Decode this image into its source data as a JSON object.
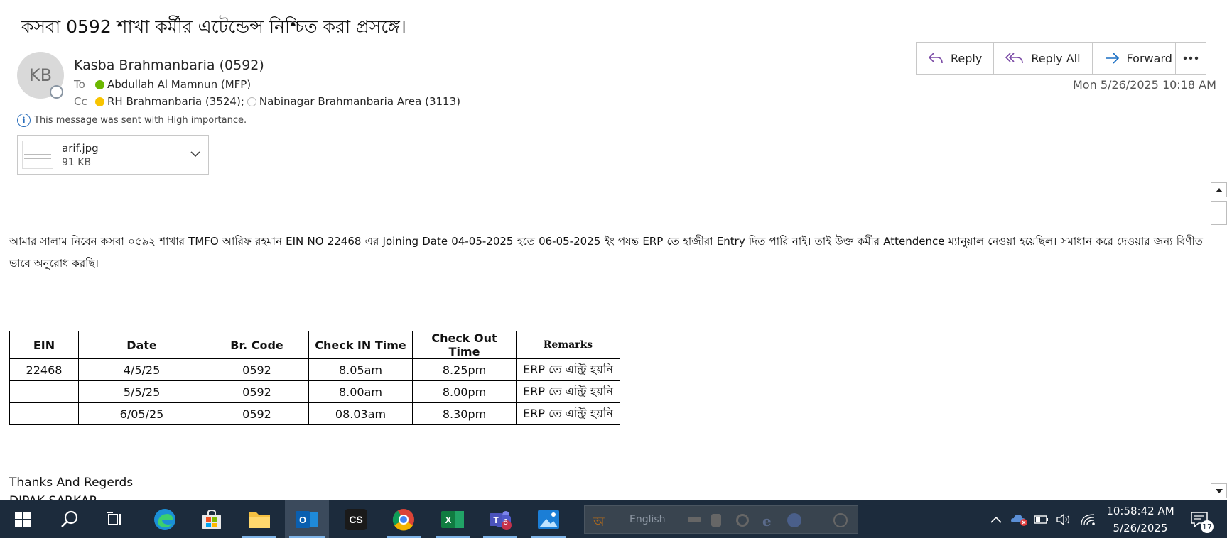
{
  "email": {
    "subject": "কসবা 0592 শাখা  কর্মীর এটেন্ডেন্স নিশ্চিত করা প্রসঙ্গে।",
    "avatar_initials": "KB",
    "sender": "Kasba Brahmanbaria (0592)",
    "to_label": "To",
    "to": "Abdullah Al Mamnun (MFP)",
    "cc_label": "Cc",
    "cc_1": "RH Brahmanbaria (3524);",
    "cc_2": "Nabinagar Brahmanbaria Area (3113)",
    "importance": "This message was sent with High importance.",
    "timestamp": "Mon 5/26/2025 10:18 AM"
  },
  "attachment": {
    "name": "arif.jpg",
    "size": "91 KB"
  },
  "actions": {
    "reply": "Reply",
    "reply_all": "Reply All",
    "forward": "Forward"
  },
  "body": {
    "paragraph": "আমার সালাম নিবেন কসবা ০৫৯২ শাখার TMFO আরিফ রহমান EIN NO 22468 এর Joining Date 04-05-2025 হতে 06-05-2025 ইং পযন্ত ERP তে হাজীরা Entry দিত পারি নাই। তাই উক্ত কর্মীর Attendence ম্যানুয়াল নেওয়া হয়েছিল। সমাধান করে দেওয়ার জন্য বিণীত ভাবে অনুরোধ করছি।",
    "table": {
      "headers": [
        "EIN",
        "Date",
        "Br. Code",
        "Check IN Time",
        "Check Out Time",
        "Remarks"
      ],
      "rows": [
        [
          "22468",
          "4/5/25",
          "0592",
          "8.05am",
          "8.25pm",
          "ERP তে এন্ট্রি হয়নি"
        ],
        [
          "",
          "5/5/25",
          "0592",
          "8.00am",
          "8.00pm",
          "ERP তে এন্ট্রি হয়নি"
        ],
        [
          "",
          "6/05/25",
          "0592",
          "08.03am",
          "8.30pm",
          "ERP তে এন্ট্রি হয়নি"
        ]
      ]
    },
    "closing": "Thanks And Regerds",
    "signer": "DIPAK SARKAR"
  },
  "taskbar": {
    "ime_label": "English",
    "teams_badge": "6",
    "clock_time": "10:58:42 AM",
    "clock_date": "5/26/2025",
    "notification_count": "17"
  },
  "colors": {
    "accent": "#2a6ebb",
    "presence_available": "#6bb700",
    "presence_away": "#f8c400",
    "taskbar": "#1c2b3c"
  }
}
